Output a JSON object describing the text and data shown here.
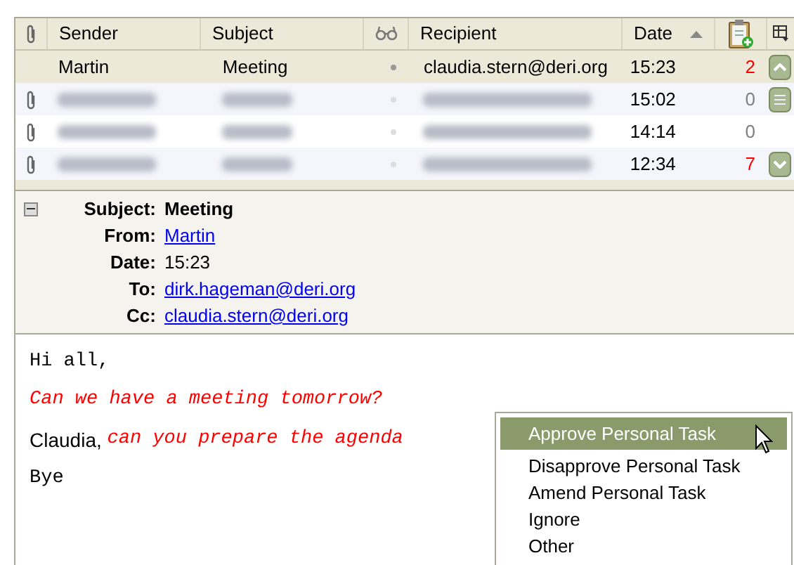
{
  "columns": [
    {
      "kind": "attachment"
    },
    {
      "kind": "text",
      "label": "Sender"
    },
    {
      "kind": "text",
      "label": "Subject"
    },
    {
      "kind": "read"
    },
    {
      "kind": "text",
      "label": "Recipient"
    },
    {
      "kind": "text",
      "label": "Date",
      "sorted": true
    },
    {
      "kind": "task"
    },
    {
      "kind": "picker"
    }
  ],
  "rows": [
    {
      "selected": true,
      "attachment": false,
      "blurred": false,
      "sender": "Martin",
      "subject": "Meeting",
      "recipient": "claudia.stern@deri.org",
      "date": "15:23",
      "count": "2",
      "color": "#ff0000"
    },
    {
      "selected": false,
      "attachment": true,
      "blurred": true,
      "date": "15:02",
      "count": "0",
      "color": "#808080"
    },
    {
      "selected": false,
      "attachment": true,
      "blurred": true,
      "date": "14:14",
      "count": "0",
      "color": "#808080"
    },
    {
      "selected": false,
      "attachment": true,
      "blurred": true,
      "date": "12:34",
      "count": "7",
      "color": "#ff0000"
    }
  ],
  "preview": {
    "expanded": true,
    "fields": [
      {
        "label": "Subject:",
        "value": "Meeting",
        "kind": "bold"
      },
      {
        "label": "From:",
        "value": "Martin",
        "kind": "link"
      },
      {
        "label": "Date:",
        "value": "15:23",
        "kind": "plain"
      },
      {
        "label": "To:",
        "value": "dirk.hageman@deri.org",
        "kind": "link"
      },
      {
        "label": "Cc:",
        "value": "claudia.stern@deri.org",
        "kind": "link"
      }
    ]
  },
  "body": [
    [
      {
        "text": "Hi all,",
        "kind": "mono"
      }
    ],
    [
      {
        "text": "Can we have a meeting tomorrow?",
        "kind": "quote"
      }
    ],
    [
      {
        "text": "Claudia, ",
        "kind": "sans"
      },
      {
        "text": "can you prepare the agenda",
        "kind": "quote"
      }
    ],
    [
      {
        "text": "Bye",
        "kind": "mono"
      }
    ]
  ],
  "menu": [
    {
      "label": "Approve Personal Task",
      "selected": true
    },
    {
      "label": "Disapprove Personal Task",
      "selected": false
    },
    {
      "label": "Amend Personal Task",
      "selected": false
    },
    {
      "label": "Ignore",
      "selected": false
    },
    {
      "label": "Other",
      "selected": false
    }
  ]
}
